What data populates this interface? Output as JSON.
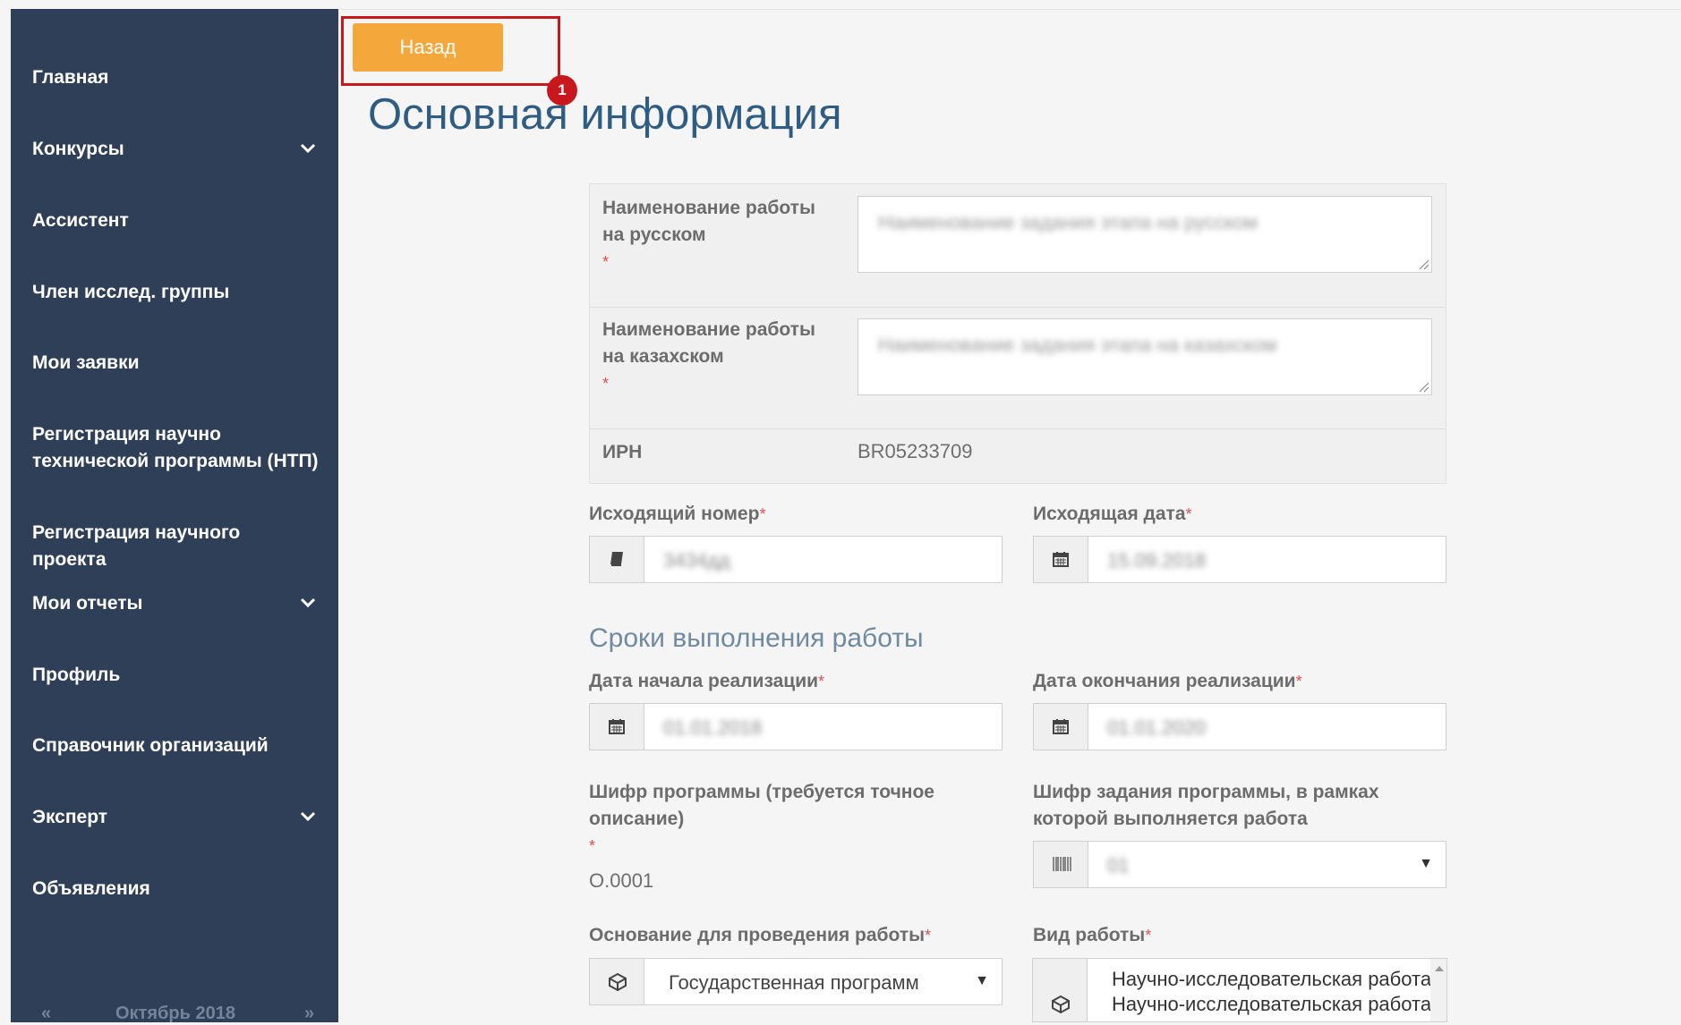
{
  "sidebar": {
    "items": [
      {
        "label": "Главная"
      },
      {
        "label": "Конкурсы"
      },
      {
        "label": "Ассистент"
      },
      {
        "label": "Член исслед. группы"
      },
      {
        "label": "Мои заявки"
      },
      {
        "label": "Регистрация научно технической программы (НТП)"
      },
      {
        "label": "Регистрация научного проекта"
      },
      {
        "label": "Мои отчеты"
      },
      {
        "label": "Профиль"
      },
      {
        "label": "Справочник организаций"
      },
      {
        "label": "Эксперт"
      },
      {
        "label": "Объявления"
      }
    ],
    "calendar": {
      "prev": "«",
      "month": "Октябрь 2018",
      "next": "»"
    }
  },
  "toolbar": {
    "back_label": "Назад",
    "badge": "1"
  },
  "page": {
    "title": "Основная информация"
  },
  "form": {
    "name_ru": {
      "label": "Наименование работы на русском",
      "required": "*",
      "value": "Наименование задания этапа на русском"
    },
    "name_kz": {
      "label": "Наименование работы на казахском",
      "required": "*",
      "value": "Наименование задания этапа на казахском"
    },
    "irn": {
      "label": "ИРН",
      "value": "BR05233709"
    },
    "out_number": {
      "label": "Исходящий номер",
      "required": "*",
      "value": "3434дд"
    },
    "out_date": {
      "label": "Исходящая дата",
      "required": "*",
      "value": "15.09.2018"
    },
    "section_title": "Сроки выполнения работы",
    "start_date": {
      "label": "Дата начала реализации",
      "required": "*",
      "value": "01.01.2018"
    },
    "end_date": {
      "label": "Дата окончания реализации",
      "required": "*",
      "value": "01.01.2020"
    },
    "program_code": {
      "label": "Шифр программы (требуется точное описание)",
      "required": "*",
      "value": "O.0001"
    },
    "task_code": {
      "label": "Шифр задания программы, в рамках которой выполняется работа",
      "value": "01"
    },
    "basis": {
      "label": "Основание для проведения работы",
      "required": "*",
      "value": "Государственная программа"
    },
    "work_type": {
      "label": "Вид работы",
      "required": "*",
      "options": [
        "Научно-исследовательская работа",
        "Научно-исследовательская работа"
      ]
    }
  }
}
